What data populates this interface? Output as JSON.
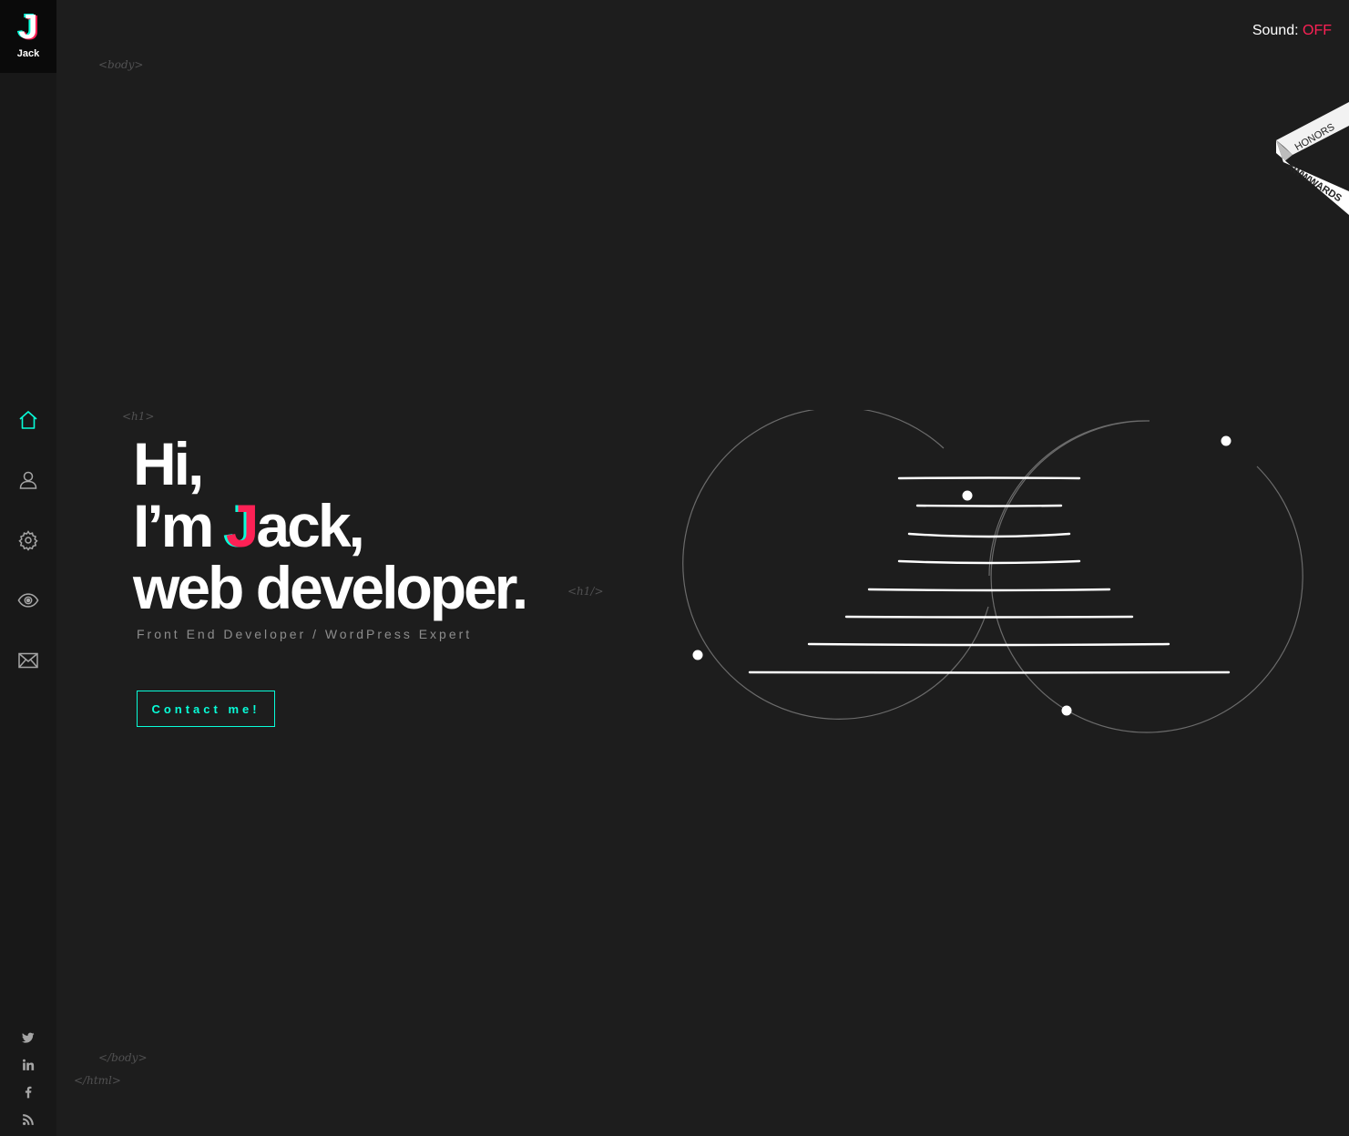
{
  "logo": {
    "letter": "J",
    "name": "Jack"
  },
  "nav": {
    "items": [
      {
        "icon": "home-icon",
        "active": true
      },
      {
        "icon": "user-icon",
        "active": false
      },
      {
        "icon": "gear-icon",
        "active": false
      },
      {
        "icon": "eye-icon",
        "active": false
      },
      {
        "icon": "mail-icon",
        "active": false
      }
    ]
  },
  "social": {
    "items": [
      "twitter-icon",
      "linkedin-icon",
      "facebook-icon",
      "rss-icon"
    ]
  },
  "code_tags": {
    "body_open": "<body>",
    "h1_open": "<h1>",
    "h1_close": "<h1/>",
    "body_close": "</body>",
    "html_close": "</html>"
  },
  "sound": {
    "label": "Sound:",
    "state": "OFF"
  },
  "ribbon": {
    "top": "HONORS",
    "bottom": "AWWWARDS"
  },
  "hero": {
    "line1": "Hi,",
    "line2_prefix": "I’m ",
    "line2_initial": "J",
    "line2_rest": "ack,",
    "line3": "web developer."
  },
  "subtitle": "Front End Developer / WordPress Expert",
  "contact_button": "Contact me!",
  "colors": {
    "accent": "#08fdd8",
    "brand_red": "#fd2155",
    "background": "#1d1d1d",
    "sidebar": "#181818"
  }
}
